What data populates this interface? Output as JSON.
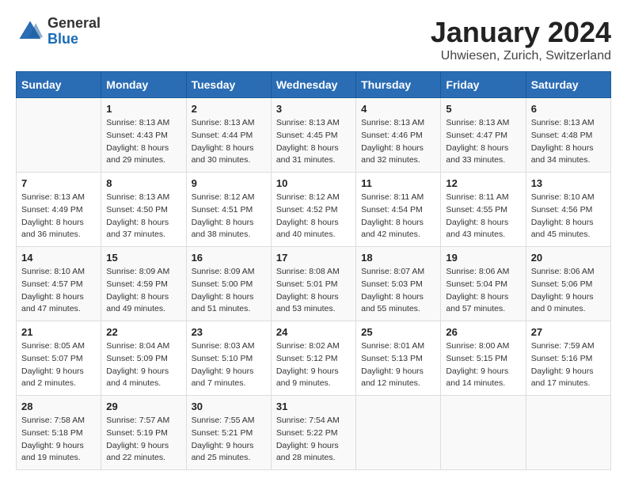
{
  "header": {
    "logo_general": "General",
    "logo_blue": "Blue",
    "title": "January 2024",
    "subtitle": "Uhwiesen, Zurich, Switzerland"
  },
  "weekdays": [
    "Sunday",
    "Monday",
    "Tuesday",
    "Wednesday",
    "Thursday",
    "Friday",
    "Saturday"
  ],
  "weeks": [
    [
      {
        "day": "",
        "sunrise": "",
        "sunset": "",
        "daylight": ""
      },
      {
        "day": "1",
        "sunrise": "Sunrise: 8:13 AM",
        "sunset": "Sunset: 4:43 PM",
        "daylight": "Daylight: 8 hours and 29 minutes."
      },
      {
        "day": "2",
        "sunrise": "Sunrise: 8:13 AM",
        "sunset": "Sunset: 4:44 PM",
        "daylight": "Daylight: 8 hours and 30 minutes."
      },
      {
        "day": "3",
        "sunrise": "Sunrise: 8:13 AM",
        "sunset": "Sunset: 4:45 PM",
        "daylight": "Daylight: 8 hours and 31 minutes."
      },
      {
        "day": "4",
        "sunrise": "Sunrise: 8:13 AM",
        "sunset": "Sunset: 4:46 PM",
        "daylight": "Daylight: 8 hours and 32 minutes."
      },
      {
        "day": "5",
        "sunrise": "Sunrise: 8:13 AM",
        "sunset": "Sunset: 4:47 PM",
        "daylight": "Daylight: 8 hours and 33 minutes."
      },
      {
        "day": "6",
        "sunrise": "Sunrise: 8:13 AM",
        "sunset": "Sunset: 4:48 PM",
        "daylight": "Daylight: 8 hours and 34 minutes."
      }
    ],
    [
      {
        "day": "7",
        "sunrise": "Sunrise: 8:13 AM",
        "sunset": "Sunset: 4:49 PM",
        "daylight": "Daylight: 8 hours and 36 minutes."
      },
      {
        "day": "8",
        "sunrise": "Sunrise: 8:13 AM",
        "sunset": "Sunset: 4:50 PM",
        "daylight": "Daylight: 8 hours and 37 minutes."
      },
      {
        "day": "9",
        "sunrise": "Sunrise: 8:12 AM",
        "sunset": "Sunset: 4:51 PM",
        "daylight": "Daylight: 8 hours and 38 minutes."
      },
      {
        "day": "10",
        "sunrise": "Sunrise: 8:12 AM",
        "sunset": "Sunset: 4:52 PM",
        "daylight": "Daylight: 8 hours and 40 minutes."
      },
      {
        "day": "11",
        "sunrise": "Sunrise: 8:11 AM",
        "sunset": "Sunset: 4:54 PM",
        "daylight": "Daylight: 8 hours and 42 minutes."
      },
      {
        "day": "12",
        "sunrise": "Sunrise: 8:11 AM",
        "sunset": "Sunset: 4:55 PM",
        "daylight": "Daylight: 8 hours and 43 minutes."
      },
      {
        "day": "13",
        "sunrise": "Sunrise: 8:10 AM",
        "sunset": "Sunset: 4:56 PM",
        "daylight": "Daylight: 8 hours and 45 minutes."
      }
    ],
    [
      {
        "day": "14",
        "sunrise": "Sunrise: 8:10 AM",
        "sunset": "Sunset: 4:57 PM",
        "daylight": "Daylight: 8 hours and 47 minutes."
      },
      {
        "day": "15",
        "sunrise": "Sunrise: 8:09 AM",
        "sunset": "Sunset: 4:59 PM",
        "daylight": "Daylight: 8 hours and 49 minutes."
      },
      {
        "day": "16",
        "sunrise": "Sunrise: 8:09 AM",
        "sunset": "Sunset: 5:00 PM",
        "daylight": "Daylight: 8 hours and 51 minutes."
      },
      {
        "day": "17",
        "sunrise": "Sunrise: 8:08 AM",
        "sunset": "Sunset: 5:01 PM",
        "daylight": "Daylight: 8 hours and 53 minutes."
      },
      {
        "day": "18",
        "sunrise": "Sunrise: 8:07 AM",
        "sunset": "Sunset: 5:03 PM",
        "daylight": "Daylight: 8 hours and 55 minutes."
      },
      {
        "day": "19",
        "sunrise": "Sunrise: 8:06 AM",
        "sunset": "Sunset: 5:04 PM",
        "daylight": "Daylight: 8 hours and 57 minutes."
      },
      {
        "day": "20",
        "sunrise": "Sunrise: 8:06 AM",
        "sunset": "Sunset: 5:06 PM",
        "daylight": "Daylight: 9 hours and 0 minutes."
      }
    ],
    [
      {
        "day": "21",
        "sunrise": "Sunrise: 8:05 AM",
        "sunset": "Sunset: 5:07 PM",
        "daylight": "Daylight: 9 hours and 2 minutes."
      },
      {
        "day": "22",
        "sunrise": "Sunrise: 8:04 AM",
        "sunset": "Sunset: 5:09 PM",
        "daylight": "Daylight: 9 hours and 4 minutes."
      },
      {
        "day": "23",
        "sunrise": "Sunrise: 8:03 AM",
        "sunset": "Sunset: 5:10 PM",
        "daylight": "Daylight: 9 hours and 7 minutes."
      },
      {
        "day": "24",
        "sunrise": "Sunrise: 8:02 AM",
        "sunset": "Sunset: 5:12 PM",
        "daylight": "Daylight: 9 hours and 9 minutes."
      },
      {
        "day": "25",
        "sunrise": "Sunrise: 8:01 AM",
        "sunset": "Sunset: 5:13 PM",
        "daylight": "Daylight: 9 hours and 12 minutes."
      },
      {
        "day": "26",
        "sunrise": "Sunrise: 8:00 AM",
        "sunset": "Sunset: 5:15 PM",
        "daylight": "Daylight: 9 hours and 14 minutes."
      },
      {
        "day": "27",
        "sunrise": "Sunrise: 7:59 AM",
        "sunset": "Sunset: 5:16 PM",
        "daylight": "Daylight: 9 hours and 17 minutes."
      }
    ],
    [
      {
        "day": "28",
        "sunrise": "Sunrise: 7:58 AM",
        "sunset": "Sunset: 5:18 PM",
        "daylight": "Daylight: 9 hours and 19 minutes."
      },
      {
        "day": "29",
        "sunrise": "Sunrise: 7:57 AM",
        "sunset": "Sunset: 5:19 PM",
        "daylight": "Daylight: 9 hours and 22 minutes."
      },
      {
        "day": "30",
        "sunrise": "Sunrise: 7:55 AM",
        "sunset": "Sunset: 5:21 PM",
        "daylight": "Daylight: 9 hours and 25 minutes."
      },
      {
        "day": "31",
        "sunrise": "Sunrise: 7:54 AM",
        "sunset": "Sunset: 5:22 PM",
        "daylight": "Daylight: 9 hours and 28 minutes."
      },
      {
        "day": "",
        "sunrise": "",
        "sunset": "",
        "daylight": ""
      },
      {
        "day": "",
        "sunrise": "",
        "sunset": "",
        "daylight": ""
      },
      {
        "day": "",
        "sunrise": "",
        "sunset": "",
        "daylight": ""
      }
    ]
  ]
}
